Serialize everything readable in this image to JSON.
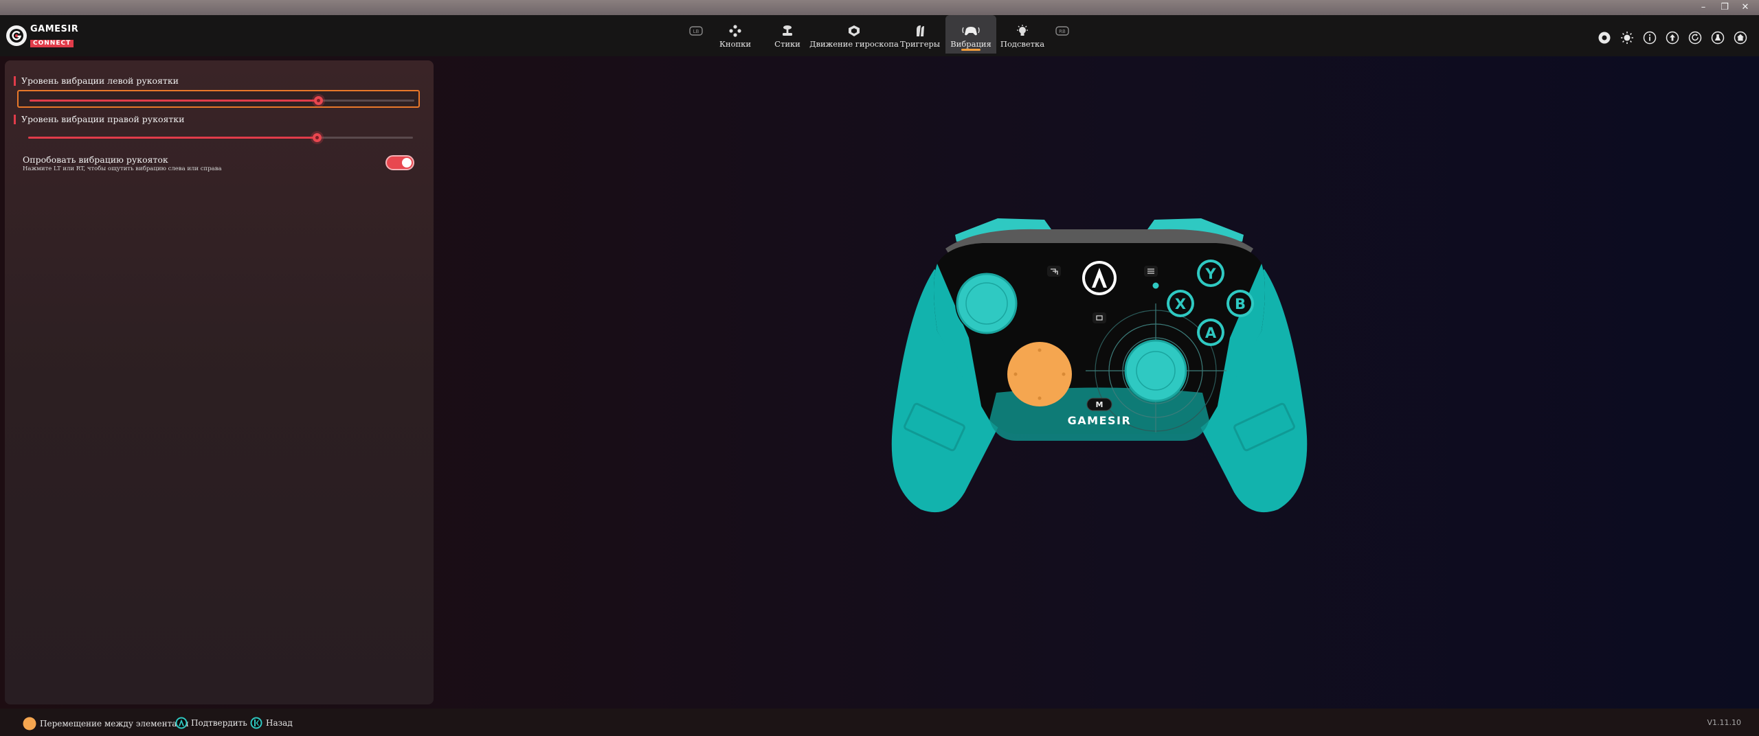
{
  "window": {
    "minimize_glyph": "–",
    "restore_glyph": "❐",
    "close_glyph": "✕"
  },
  "logo": {
    "line1": "GAMESIR",
    "line2": "CONNECT"
  },
  "tabs": [
    {
      "id": "prev",
      "label": "",
      "icon": "lb-bumper-icon"
    },
    {
      "id": "buttons",
      "label": "Кнопки",
      "icon": "gamepad-buttons-icon"
    },
    {
      "id": "sticks",
      "label": "Стики",
      "icon": "joystick-icon"
    },
    {
      "id": "gyro",
      "label": "Движение гироскопа",
      "icon": "gyroscope-icon"
    },
    {
      "id": "triggers",
      "label": "Триггеры",
      "icon": "trigger-icon"
    },
    {
      "id": "vibration",
      "label": "Вибрация",
      "icon": "vibration-icon",
      "active": true
    },
    {
      "id": "lighting",
      "label": "Подсветка",
      "icon": "lightbulb-icon"
    },
    {
      "id": "next",
      "label": "",
      "icon": "rb-bumper-icon"
    }
  ],
  "toolbar_icons": [
    "record-icon",
    "brightness-icon",
    "info-icon",
    "upload-icon",
    "refresh-icon",
    "lab-flask-icon",
    "home-icon"
  ],
  "vibration": {
    "left": {
      "label": "Уровень вибрации левой рукоятки",
      "value": 75,
      "focused": true
    },
    "right": {
      "label": "Уровень вибрации правой рукоятки",
      "value": 75,
      "focused": false
    },
    "test": {
      "label": "Опробовать вибрацию рукояток",
      "description": "Нажмите LT или RT, чтобы ощутить вибрацию слева или справа",
      "enabled": true
    }
  },
  "gamepad": {
    "brand": "GAMESIR",
    "m_button": "M",
    "face_buttons": [
      "Y",
      "X",
      "B",
      "A"
    ],
    "colors": {
      "body": "#12b3ad",
      "face": "#0b0b0b",
      "highlight_stick": "#f5a650",
      "accent": "#2fc9c2"
    }
  },
  "bottom_hints": [
    {
      "icon": "left-stick-icon",
      "label": "Перемещение между элементами"
    },
    {
      "icon": "a-button-icon",
      "label": "Подтвердить"
    },
    {
      "icon": "b-button-icon",
      "label": "Назад"
    }
  ],
  "version": "V1.11.10"
}
